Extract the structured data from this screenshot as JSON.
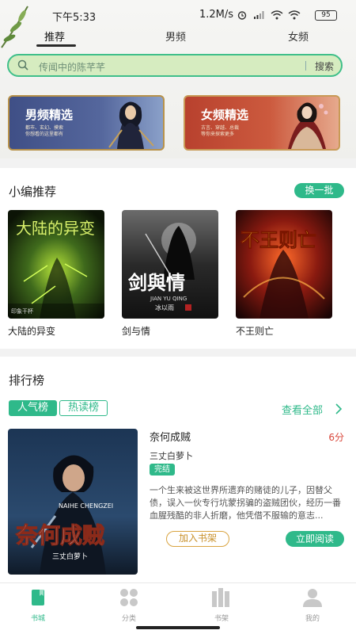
{
  "status_bar": {
    "time": "下午5:33",
    "speed": "1.2M/s",
    "battery": "95"
  },
  "top_nav": {
    "tabs": [
      "推荐",
      "男频",
      "女频"
    ],
    "active_index": 0
  },
  "search": {
    "placeholder": "传闻中的陈芊芊",
    "button": "搜索"
  },
  "channels": [
    {
      "title": "男频精选",
      "tags": "都市、玄幻、摸索",
      "tagline": "你想看的这里都有"
    },
    {
      "title": "女频精选",
      "tags": "古言、穿越、总裁",
      "tagline": "等你来探索更多"
    }
  ],
  "editor_picks": {
    "title": "小编推荐",
    "swap_button": "换一批",
    "books": [
      {
        "name": "大陆的异变",
        "cover_text": "大陆的异变",
        "cover_author": "印象干杯"
      },
      {
        "name": "剑与情",
        "cover_text": "剑與情",
        "cover_pinyin": "JIAN YU QING",
        "cover_author": "冰以雨"
      },
      {
        "name": "不王则亡",
        "cover_text": "不王则亡"
      }
    ]
  },
  "ranking": {
    "title": "排行榜",
    "tabs": [
      "人气榜",
      "热读榜"
    ],
    "active_tab": 0,
    "see_all": "查看全部",
    "featured": {
      "title": "奈何成贼",
      "score": "6分",
      "author": "三丈白萝卜",
      "status": "完结",
      "description": "一个生来被这世界所遗弃的赌徒的儿子，因替父债，误入一伙专行坑蒙拐骗的盗贼团伙，经历一番血腥残酷的非人折磨，他凭借不服输的意志...",
      "cover_title": "奈何成贼",
      "cover_pinyin": "NAIHE CHENGZEI",
      "cover_author": "三丈白萝卜",
      "add_button": "加入书架",
      "read_button": "立即阅读"
    }
  },
  "tab_bar": {
    "items": [
      {
        "label": "书城",
        "icon": "book-icon"
      },
      {
        "label": "分类",
        "icon": "category-icon"
      },
      {
        "label": "书架",
        "icon": "bookshelf-icon"
      },
      {
        "label": "我的",
        "icon": "user-icon"
      }
    ],
    "active_index": 0
  },
  "colors": {
    "accent": "#2fb98a",
    "search_bg": "#d6ecc0",
    "score": "#d9473b",
    "add_button": "#c8902a"
  }
}
